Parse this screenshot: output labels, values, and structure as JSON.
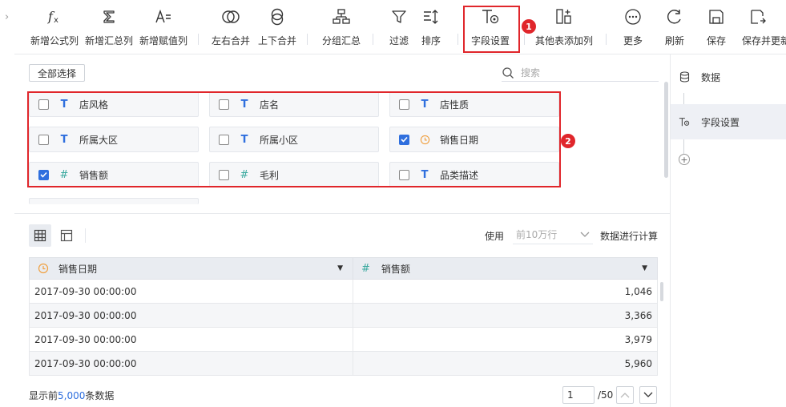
{
  "toolbar": {
    "items": [
      {
        "label": "新增公式列",
        "icon": "fx-icon"
      },
      {
        "label": "新增汇总列",
        "icon": "sigma-icon"
      },
      {
        "label": "新增赋值列",
        "icon": "assign-icon"
      },
      {
        "label": "左右合并",
        "icon": "merge-lr-icon"
      },
      {
        "label": "上下合并",
        "icon": "merge-tb-icon"
      },
      {
        "label": "分组汇总",
        "icon": "group-icon"
      },
      {
        "label": "过滤",
        "icon": "filter-icon"
      },
      {
        "label": "排序",
        "icon": "sort-icon"
      },
      {
        "label": "字段设置",
        "icon": "field-settings-icon"
      },
      {
        "label": "其他表添加列",
        "icon": "add-col-icon"
      },
      {
        "label": "更多",
        "icon": "more-icon"
      },
      {
        "label": "刷新",
        "icon": "refresh-icon"
      },
      {
        "label": "保存",
        "icon": "save-icon"
      },
      {
        "label": "保存并更新",
        "icon": "save-update-icon"
      }
    ],
    "badge1": "1"
  },
  "fields": {
    "select_all": "全部选择",
    "search_placeholder": "搜索",
    "badge2": "2",
    "items": [
      {
        "name": "店风格",
        "type": "text",
        "checked": false
      },
      {
        "name": "店名",
        "type": "text",
        "checked": false
      },
      {
        "name": "店性质",
        "type": "text",
        "checked": false
      },
      {
        "name": "所属大区",
        "type": "text",
        "checked": false
      },
      {
        "name": "所属小区",
        "type": "text",
        "checked": false
      },
      {
        "name": "销售日期",
        "type": "date",
        "checked": true
      },
      {
        "name": "销售额",
        "type": "number",
        "checked": true
      },
      {
        "name": "毛利",
        "type": "number",
        "checked": false
      },
      {
        "name": "品类描述",
        "type": "text",
        "checked": false
      }
    ]
  },
  "preview": {
    "use_label": "使用",
    "row_limit": "前10万行",
    "calc_label": "数据进行计算",
    "columns": [
      {
        "name": "销售日期",
        "type": "date"
      },
      {
        "name": "销售额",
        "type": "number"
      }
    ],
    "rows": [
      [
        "2017-09-30 00:00:00",
        "1,046"
      ],
      [
        "2017-09-30 00:00:00",
        "3,366"
      ],
      [
        "2017-09-30 00:00:00",
        "3,979"
      ],
      [
        "2017-09-30 00:00:00",
        "5,960"
      ]
    ],
    "footer_prefix": "显示前",
    "footer_count": "5,000",
    "footer_suffix": "条数据",
    "page": "1",
    "page_total": "/50"
  },
  "steps": [
    {
      "label": "数据",
      "icon": "database-icon"
    },
    {
      "label": "字段设置",
      "icon": "field-settings-icon"
    }
  ],
  "colors": {
    "accent": "#2f6fde",
    "highlight": "#e0262b",
    "date_icon": "#f0a040",
    "number_icon": "#3aa99f"
  }
}
